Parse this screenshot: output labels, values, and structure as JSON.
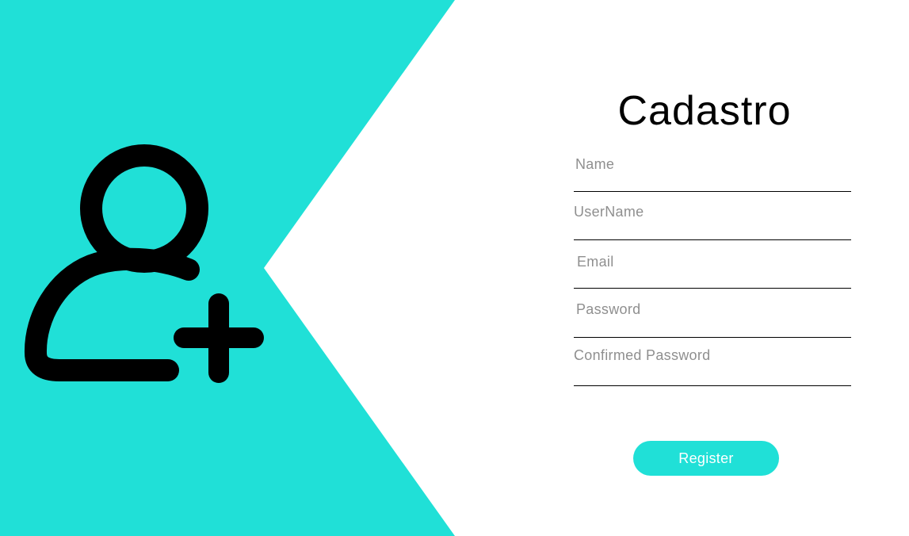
{
  "page": {
    "title": "Cadastro"
  },
  "colors": {
    "accent": "#20e0d7",
    "icon": "#000000",
    "background": "#ffffff"
  },
  "icons": {
    "hero": "user-add-icon"
  },
  "form": {
    "fields": [
      {
        "label": "Name",
        "value": ""
      },
      {
        "label": "UserName",
        "value": ""
      },
      {
        "label": "Email",
        "value": ""
      },
      {
        "label": "Password",
        "value": ""
      },
      {
        "label": "Confirmed Password",
        "value": ""
      }
    ],
    "submit_label": "Register"
  }
}
